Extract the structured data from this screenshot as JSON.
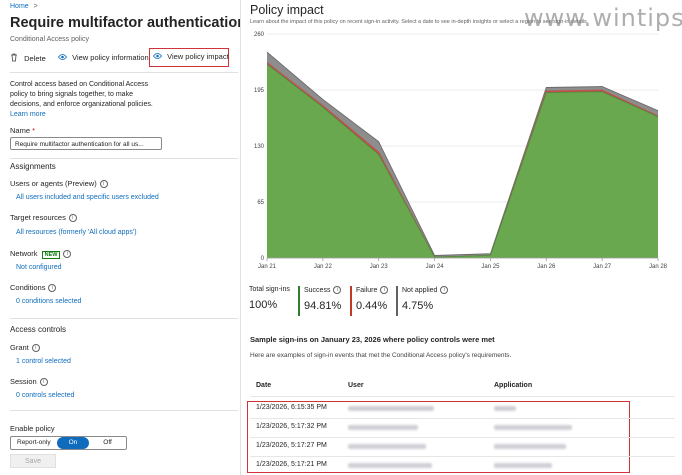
{
  "breadcrumb": {
    "home": "Home",
    "chevron": ">"
  },
  "page": {
    "title": "Require multifactor authentication for",
    "subtitle": "Conditional Access policy"
  },
  "toolbar": {
    "delete": "Delete",
    "view_info": "View policy information",
    "view_impact": "View policy impact"
  },
  "description": {
    "line1": "Control access based on Conditional Access",
    "line2": "policy to bring signals together, to make",
    "line3": "decisions, and enforce organizational policies.",
    "learn_more": "Learn more"
  },
  "name_field": {
    "label": "Name",
    "required": "*",
    "value": "Require multifactor authentication for all us..."
  },
  "assignments": {
    "heading": "Assignments",
    "users_label": "Users or agents (Preview)",
    "users_value": "All users included and specific users excluded",
    "target_label": "Target resources",
    "target_value": "All resources (formerly 'All cloud apps')",
    "network_label": "Network",
    "network_badge": "NEW",
    "network_value": "Not configured",
    "conditions_label": "Conditions",
    "conditions_value": "0 conditions selected"
  },
  "access_controls": {
    "heading": "Access controls",
    "grant_label": "Grant",
    "grant_value": "1 control selected",
    "session_label": "Session",
    "session_value": "0 controls selected"
  },
  "enable_policy": {
    "label": "Enable policy",
    "options": [
      "Report-only",
      "On",
      "Off"
    ],
    "selected": "On",
    "save": "Save"
  },
  "panel": {
    "title": "Policy impact",
    "subtitle": "Learn about the impact of this policy on recent sign-in activity. Select a date to see in-depth insights or select a region to see sign-in details."
  },
  "chart_data": {
    "type": "area",
    "x": [
      "Jan 21",
      "Jan 22",
      "Jan 23",
      "Jan 24",
      "Jan 25",
      "Jan 26",
      "Jan 27",
      "Jan 28"
    ],
    "ylim": [
      0,
      260
    ],
    "yticks": [
      "260",
      "195",
      "130",
      "65",
      "0"
    ],
    "series": [
      {
        "name": "Success",
        "color": "#6aa84f",
        "values": [
          225,
          175,
          120,
          1,
          3,
          192,
          193,
          164
        ]
      },
      {
        "name": "Failure",
        "color": "#c0504d",
        "values": [
          2,
          2,
          3,
          0,
          0,
          2,
          2,
          1
        ]
      },
      {
        "name": "Not applied",
        "color": "#8d8d8d",
        "values": [
          12,
          7,
          12,
          2,
          2,
          4,
          4,
          6
        ]
      }
    ]
  },
  "metrics": [
    {
      "label": "Total sign-ins",
      "value": "100%",
      "color": ""
    },
    {
      "label": "Success",
      "value": "94.81%",
      "color": "#2e7d32"
    },
    {
      "label": "Failure",
      "value": "0.44%",
      "color": "#c0392b"
    },
    {
      "label": "Not applied",
      "value": "4.75%",
      "color": "#616161"
    }
  ],
  "samples": {
    "heading": "Sample sign-ins on January 23, 2026 where policy controls were met",
    "description": "Here are examples of sign-in events that met the Conditional Access policy's requirements.",
    "columns": [
      "Date",
      "User",
      "Application"
    ],
    "rows": [
      {
        "date": "1/23/2026, 6:15:35 PM"
      },
      {
        "date": "1/23/2026, 5:17:32 PM"
      },
      {
        "date": "1/23/2026, 5:17:27 PM"
      },
      {
        "date": "1/23/2026, 5:17:21 PM"
      }
    ]
  },
  "watermark": "www.wintips.org"
}
